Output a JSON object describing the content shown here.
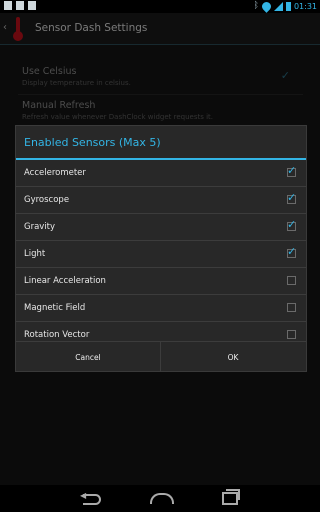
{
  "status_bar": {
    "time": "01:31",
    "icons": [
      "image-icon",
      "download-icon",
      "briefcase-icon",
      "bluetooth-icon",
      "wifi-icon",
      "signal-icon",
      "battery-icon"
    ]
  },
  "action_bar": {
    "title": "Sensor Dash Settings",
    "app_icon": "thermometer-icon"
  },
  "settings": {
    "use_celsius": {
      "title": "Use Celsius",
      "summary": "Display temperature in celsius.",
      "checked": true
    },
    "manual_refresh": {
      "title": "Manual Refresh",
      "summary": "Refresh value whenever DashClock widget requests it.",
      "checked": false
    }
  },
  "dialog": {
    "title": "Enabled Sensors (Max 5)",
    "items": [
      {
        "label": "Accelerometer",
        "checked": true
      },
      {
        "label": "Gyroscope",
        "checked": true
      },
      {
        "label": "Gravity",
        "checked": true
      },
      {
        "label": "Light",
        "checked": true
      },
      {
        "label": "Linear Acceleration",
        "checked": false
      },
      {
        "label": "Magnetic Field",
        "checked": false
      },
      {
        "label": "Rotation Vector",
        "checked": false
      }
    ],
    "cancel_label": "Cancel",
    "ok_label": "OK"
  },
  "colors": {
    "accent": "#33b5e5",
    "dialog_bg": "#282828",
    "thermometer": "#c1121c"
  },
  "nav_bar": {
    "icons": [
      "back-icon",
      "home-icon",
      "recent-apps-icon"
    ]
  }
}
